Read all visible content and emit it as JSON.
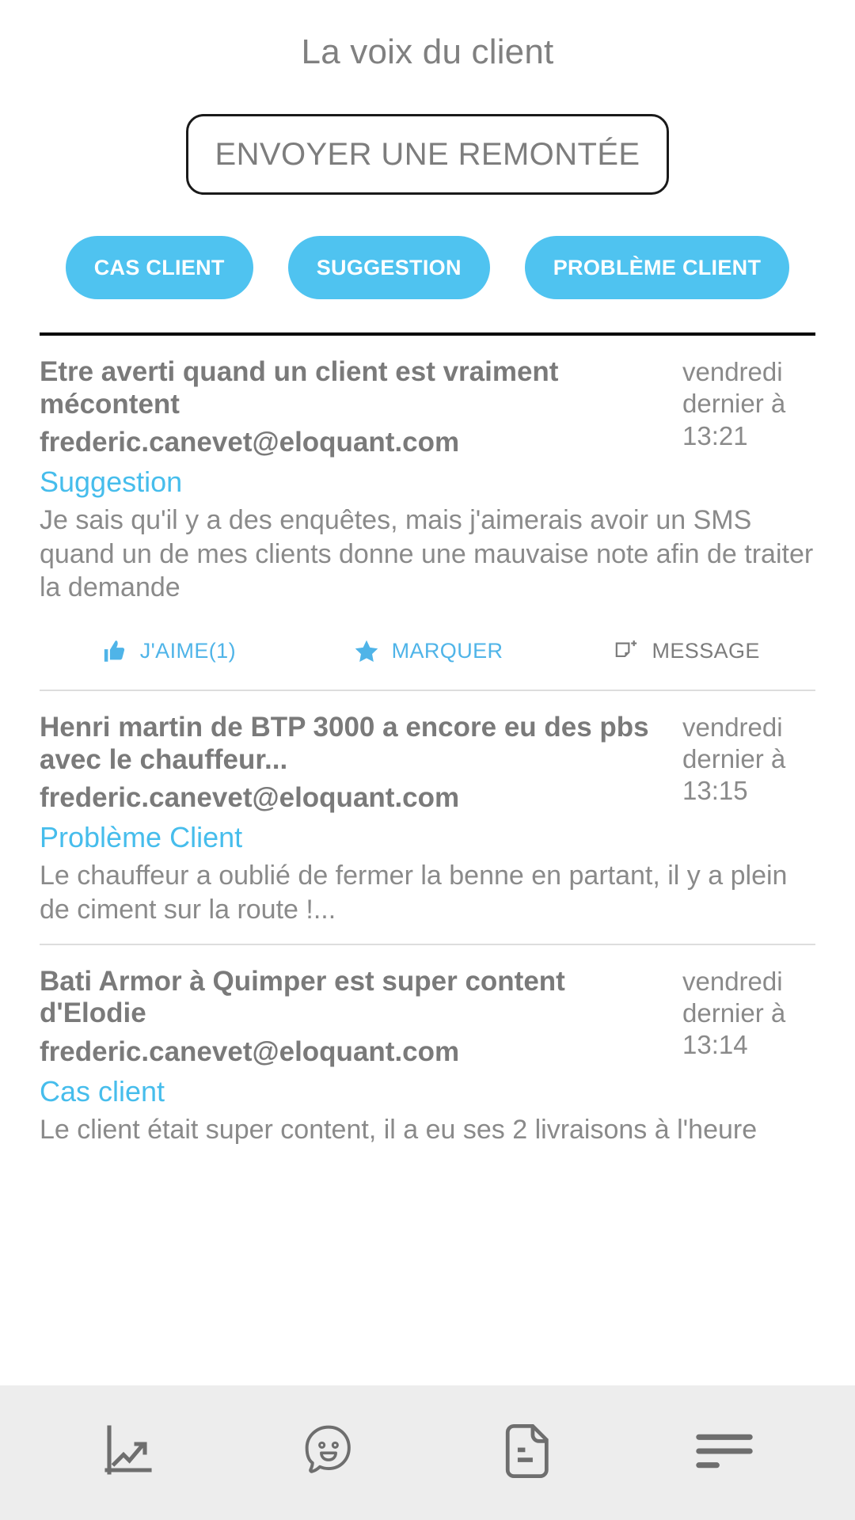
{
  "header": {
    "title": "La voix du client"
  },
  "cta": {
    "label": "ENVOYER UNE REMONTÉE"
  },
  "filters": [
    {
      "label": "CAS CLIENT",
      "name": "filter-cas-client"
    },
    {
      "label": "SUGGESTION",
      "name": "filter-suggestion"
    },
    {
      "label": "PROBLÈME CLIENT",
      "name": "filter-probleme-client"
    }
  ],
  "colors": {
    "accent": "#4fc3f0",
    "category_link": "#46bdec",
    "text_gray": "#7a7a7a",
    "muted_gray": "#8a8a8a",
    "nav_bg": "#ededed",
    "nav_icon": "#6e6e6e"
  },
  "feed": [
    {
      "title": "Etre averti quand un client est vraiment mécontent",
      "email": "frederic.canevet@eloquant.com",
      "category": "Suggestion",
      "date": "vendredi dernier à 13:21",
      "body": "Je sais qu'il y a des enquêtes, mais j'aimerais avoir un SMS quand un de mes clients donne une mauvaise note afin de traiter la demande",
      "actions": [
        {
          "label": "J'AIME(1)",
          "icon": "thumbs-up-icon",
          "name": "like-action",
          "muted": false
        },
        {
          "label": "MARQUER",
          "icon": "star-icon",
          "name": "bookmark-action",
          "muted": false
        },
        {
          "label": "MESSAGE",
          "icon": "new-message-icon",
          "name": "message-action",
          "muted": true
        }
      ]
    },
    {
      "title": "Henri martin de BTP 3000 a encore eu des pbs avec le chauffeur...",
      "email": "frederic.canevet@eloquant.com",
      "category": "Problème Client",
      "date": "vendredi dernier à 13:15",
      "body": "Le chauffeur a oublié de fermer la benne en partant, il y a plein de ciment sur la route !...",
      "actions": []
    },
    {
      "title": "Bati Armor à Quimper est super content d'Elodie",
      "email": "frederic.canevet@eloquant.com",
      "category": "Cas client",
      "date": "vendredi dernier à 13:14",
      "body": "Le client était super content, il a eu ses 2 livraisons à l'heure",
      "actions": []
    }
  ],
  "bottom_nav": [
    {
      "icon": "chart-trending-up-icon",
      "name": "nav-statistics"
    },
    {
      "icon": "smiley-speech-bubble-icon",
      "name": "nav-feedback"
    },
    {
      "icon": "document-icon",
      "name": "nav-documents"
    },
    {
      "icon": "menu-icon",
      "name": "nav-menu"
    }
  ]
}
